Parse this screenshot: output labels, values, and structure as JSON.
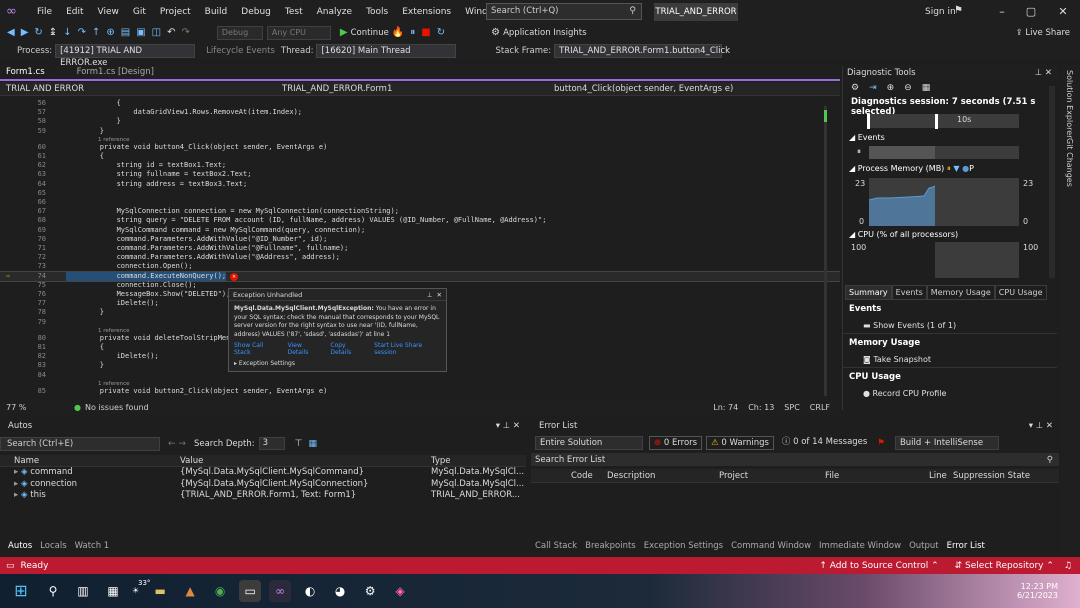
{
  "title_bar": {
    "menu": [
      "File",
      "Edit",
      "View",
      "Git",
      "Project",
      "Build",
      "Debug",
      "Test",
      "Analyze",
      "Tools",
      "Extensions",
      "Window",
      "Help"
    ],
    "search_placeholder": "Search (Ctrl+Q)",
    "solution_name": "TRIAL_AND_ERROR",
    "sign_in": "Sign in"
  },
  "toolbar1": {
    "config_dd": "Debug",
    "platform_dd": "Any CPU",
    "continue_label": "Continue",
    "app_insights": "Application Insights",
    "live_share": "Live Share"
  },
  "toolbar2": {
    "process_label": "Process:",
    "process_value": "[41912] TRIAL AND ERROR.exe",
    "lifecycle_label": "Lifecycle Events",
    "thread_label": "Thread:",
    "thread_value": "[16620] Main Thread",
    "stack_label": "Stack Frame:",
    "stack_value": "TRIAL_AND_ERROR.Form1.button4_Click"
  },
  "doc_tabs": [
    {
      "label": "Form1.cs",
      "active": true
    },
    {
      "label": "Form1.cs [Design]",
      "active": false
    }
  ],
  "nav": {
    "project": "TRIAL AND ERROR",
    "class": "TRIAL_AND_ERROR.Form1",
    "member": "button4_Click(object sender, EventArgs e)"
  },
  "code_lines": [
    {
      "n": "56",
      "t": "            {"
    },
    {
      "n": "57",
      "t": "                dataGridView1.Rows.RemoveAt(item.Index);"
    },
    {
      "n": "58",
      "t": "            }"
    },
    {
      "n": "59",
      "t": "        }"
    },
    {
      "n": "",
      "ref": "1 reference"
    },
    {
      "n": "60",
      "t": "        private void button4_Click(object sender, EventArgs e)"
    },
    {
      "n": "61",
      "t": "        {"
    },
    {
      "n": "62",
      "t": "            string id = textBox1.Text;"
    },
    {
      "n": "63",
      "t": "            string fullname = textBox2.Text;"
    },
    {
      "n": "64",
      "t": "            string address = textBox3.Text;"
    },
    {
      "n": "65",
      "t": ""
    },
    {
      "n": "66",
      "t": ""
    },
    {
      "n": "67",
      "t": "            MySqlConnection connection = new MySqlConnection(connectionString);"
    },
    {
      "n": "68",
      "t": "            string query = \"DELETE FROM account (ID, fullName, address) VALUES (@ID_Number, @FullName, @Address)\";"
    },
    {
      "n": "69",
      "t": "            MySqlCommand command = new MySqlCommand(query, connection);"
    },
    {
      "n": "70",
      "t": "            command.Parameters.AddWithValue(\"@ID_Number\", id);"
    },
    {
      "n": "71",
      "t": "            command.Parameters.AddWithValue(\"@Fullname\", fullname);"
    },
    {
      "n": "72",
      "t": "            command.Parameters.AddWithValue(\"@Address\", address);"
    },
    {
      "n": "73",
      "t": "            connection.Open();"
    },
    {
      "n": "74",
      "t": "            command.ExecuteNonQuery();"
    },
    {
      "n": "75",
      "t": "            connection.Close();"
    },
    {
      "n": "76",
      "t": "            MessageBox.Show(\"DELETED\");"
    },
    {
      "n": "77",
      "t": "            iDelete();"
    },
    {
      "n": "78",
      "t": "        }"
    },
    {
      "n": "79",
      "t": ""
    },
    {
      "n": "",
      "ref": "1 reference"
    },
    {
      "n": "80",
      "t": "        private void deleteToolStripMen"
    },
    {
      "n": "81",
      "t": "        {"
    },
    {
      "n": "82",
      "t": "            iDelete();"
    },
    {
      "n": "83",
      "t": "        }"
    },
    {
      "n": "84",
      "t": ""
    },
    {
      "n": "",
      "ref": "1 reference"
    },
    {
      "n": "85",
      "t": "        private void button2_Click(object sender, EventArgs e)"
    }
  ],
  "exception": {
    "title": "Exception Unhandled",
    "type": "MySql.Data.MySqlClient.MySqlException:",
    "message": "You have an error in your SQL syntax; check the manual that corresponds to your MySQL server version for the right syntax to use near '(ID, fullName, address) VALUES ('87', 'sdasd', 'asdasdas')' at line 1",
    "links": [
      "Show Call Stack",
      "View Details",
      "Copy Details",
      "Start Live Share session"
    ],
    "settings": "Exception Settings"
  },
  "editor_status": {
    "zoom": "77 %",
    "issues": "No issues found",
    "ln": "Ln: 74",
    "ch": "Ch: 13",
    "spc": "SPC",
    "crlf": "CRLF"
  },
  "diagnostic": {
    "title": "Diagnostic Tools",
    "session": "Diagnostics session: 7 seconds (7.51 s selected)",
    "time_label": "10s",
    "events": "Events",
    "process_memory": "Process Memory (MB)",
    "mem_max": "23",
    "mem_min": "0",
    "mem_legend": "P",
    "cpu": "CPU (% of all processors)",
    "cpu_max": "100",
    "tabs": [
      "Summary",
      "Events",
      "Memory Usage",
      "CPU Usage"
    ],
    "summary_events": "Events",
    "show_events": "Show Events (1 of 1)",
    "memory_usage": "Memory Usage",
    "take_snapshot": "Take Snapshot",
    "cpu_usage": "CPU Usage",
    "record_cpu": "Record CPU Profile"
  },
  "side_tabs": [
    "Solution Explorer",
    "Git Changes"
  ],
  "autos": {
    "title": "Autos",
    "search_placeholder": "Search (Ctrl+E)",
    "depth_label": "Search Depth:",
    "depth_value": "3",
    "columns": [
      "Name",
      "Value",
      "Type"
    ],
    "rows": [
      {
        "name": "command",
        "value": "{MySql.Data.MySqlClient.MySqlCommand}",
        "type": "MySql.Data.MySqlCl..."
      },
      {
        "name": "connection",
        "value": "{MySql.Data.MySqlClient.MySqlConnection}",
        "type": "MySql.Data.MySqlCl..."
      },
      {
        "name": "this",
        "value": "{TRIAL_AND_ERROR.Form1, Text: Form1}",
        "type": "TRIAL_AND_ERROR..."
      }
    ],
    "tabs": [
      "Autos",
      "Locals",
      "Watch 1"
    ]
  },
  "errorlist": {
    "title": "Error List",
    "scope": "Entire Solution",
    "errors": "0 Errors",
    "warnings": "0 Warnings",
    "messages": "0 of 14 Messages",
    "build_dd": "Build + IntelliSense",
    "search_placeholder": "Search Error List",
    "columns": [
      "Code",
      "Description",
      "Project",
      "File",
      "Line",
      "Suppression State"
    ],
    "tabs": [
      "Call Stack",
      "Breakpoints",
      "Exception Settings",
      "Command Window",
      "Immediate Window",
      "Output",
      "Error List"
    ]
  },
  "statusbar": {
    "ready": "Ready",
    "add_source": "Add to Source Control",
    "select_repo": "Select Repository"
  },
  "taskbar": {
    "temp": "33°",
    "time": "12:23 PM",
    "date": "6/21/2023"
  },
  "colors": {
    "accent": "#9b6bdf",
    "status": "#bb1a30",
    "memory": "#5b9bd5"
  }
}
